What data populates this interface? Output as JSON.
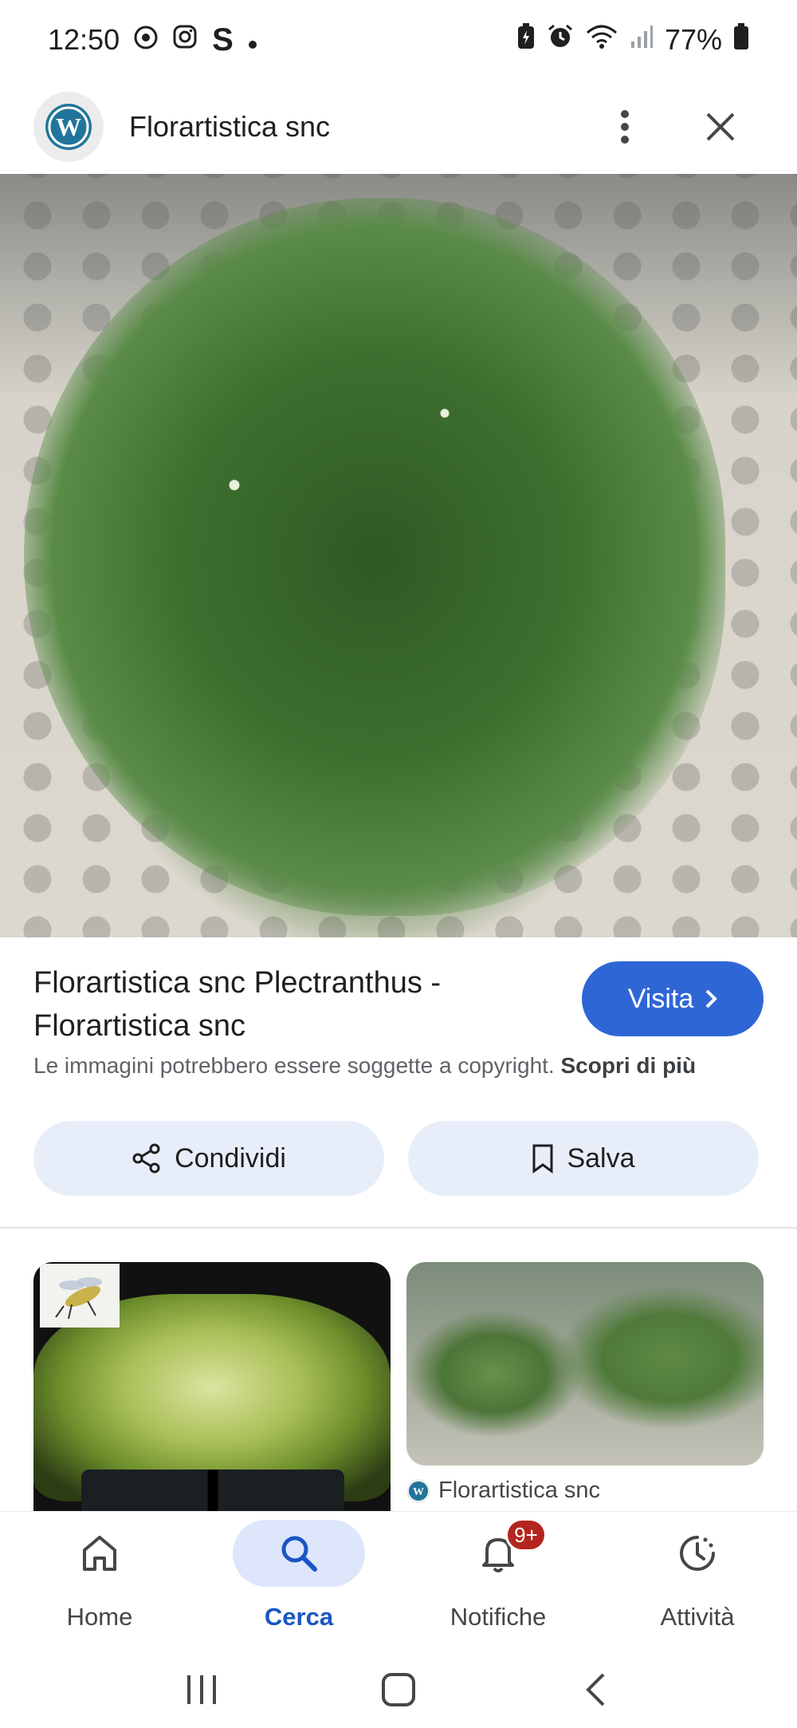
{
  "status_bar": {
    "time": "12:50",
    "battery": "77%",
    "left_icons": [
      "chrome-icon",
      "instagram-icon",
      "s-app-icon",
      "dot-icon"
    ],
    "right_icons": [
      "battery-saver-icon",
      "alarm-icon",
      "wifi-icon",
      "signal-icon",
      "battery-icon"
    ]
  },
  "header": {
    "site_name": "Florartistica snc",
    "logo_icon": "wordpress-icon"
  },
  "result": {
    "title": "Florartistica snc Plectranthus - Florartistica snc",
    "visit_label": "Visita",
    "copyright_text": "Le immagini potrebbero essere soggette a copyright.",
    "learn_more": "Scopri di più",
    "share_label": "Condividi",
    "save_label": "Salva"
  },
  "related": {
    "items": [
      {
        "source": ""
      },
      {
        "source": "Florartistica snc"
      }
    ]
  },
  "bottom_nav": {
    "items": [
      {
        "label": "Home",
        "icon": "home-icon"
      },
      {
        "label": "Cerca",
        "icon": "search-icon",
        "active": true
      },
      {
        "label": "Notifiche",
        "icon": "bell-icon",
        "badge": "9+"
      },
      {
        "label": "Attività",
        "icon": "activity-icon"
      }
    ]
  },
  "colors": {
    "accent": "#2f66d6",
    "pill_bg": "#e8eef9",
    "active_nav_bg": "#dde6fb",
    "badge": "#b3261e"
  }
}
